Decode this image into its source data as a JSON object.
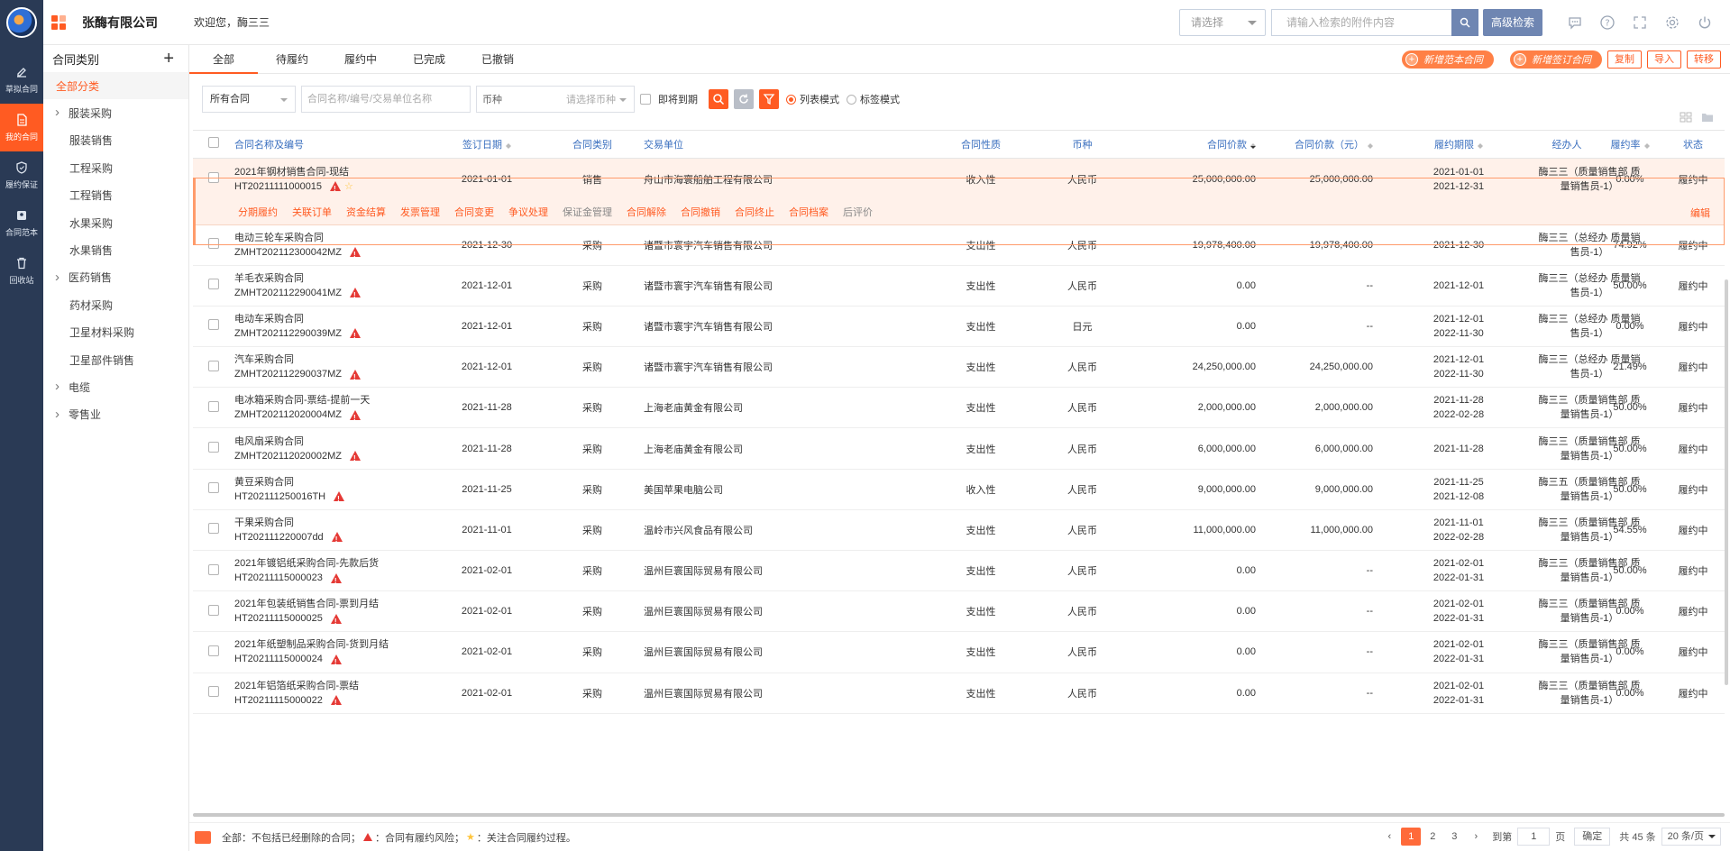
{
  "rail": {
    "items": [
      {
        "label": "草拟合同",
        "icon": "edit-icon",
        "active": false
      },
      {
        "label": "我的合同",
        "icon": "document-icon",
        "active": true
      },
      {
        "label": "履约保证",
        "icon": "shield-icon",
        "active": false
      },
      {
        "label": "合同范本",
        "icon": "template-icon",
        "active": false
      },
      {
        "label": "回收站",
        "icon": "trash-icon",
        "active": false
      }
    ]
  },
  "header": {
    "company": "张酶有限公司",
    "welcome": "欢迎您，酶三三",
    "select_placeholder": "请选择",
    "search_placeholder": "请输入检索的附件内容",
    "advanced_search": "高级检索"
  },
  "sidebar": {
    "title": "合同类别",
    "items": [
      {
        "label": "全部分类",
        "type": "active"
      },
      {
        "label": "服装采购",
        "type": "parent"
      },
      {
        "label": "服装销售",
        "type": "child"
      },
      {
        "label": "工程采购",
        "type": "child"
      },
      {
        "label": "工程销售",
        "type": "child"
      },
      {
        "label": "水果采购",
        "type": "child"
      },
      {
        "label": "水果销售",
        "type": "child"
      },
      {
        "label": "医药销售",
        "type": "parent"
      },
      {
        "label": "药材采购",
        "type": "child"
      },
      {
        "label": "卫星材料采购",
        "type": "child"
      },
      {
        "label": "卫星部件销售",
        "type": "child"
      },
      {
        "label": "电缆",
        "type": "parent"
      },
      {
        "label": "零售业",
        "type": "parent"
      }
    ]
  },
  "tabs": [
    "全部",
    "待履约",
    "履约中",
    "已完成",
    "已撤销"
  ],
  "actions": {
    "new_template": "新增范本合同",
    "new_signed": "新增签订合同",
    "copy": "复制",
    "import": "导入",
    "transfer": "转移"
  },
  "filters": {
    "contract_scope": "所有合同",
    "keyword_placeholder": "合同名称/编号/交易单位名称",
    "currency_label": "币种",
    "currency_placeholder": "请选择币种",
    "expiring": "即将到期",
    "list_mode": "列表模式",
    "tag_mode": "标签模式"
  },
  "table": {
    "columns": [
      "合同名称及编号",
      "签订日期",
      "合同类别",
      "交易单位",
      "合同性质",
      "币种",
      "合同价款",
      "合同价款（元）",
      "履约期限",
      "经办人",
      "履约率",
      "状态"
    ],
    "row_actions": [
      "分期履约",
      "关联订单",
      "资金结算",
      "发票管理",
      "合同变更",
      "争议处理",
      "保证金管理",
      "合同解除",
      "合同撤销",
      "合同终止",
      "合同档案",
      "后评价"
    ],
    "edit_label": "编辑",
    "rows": [
      {
        "name": "2021年钢材销售合同-现结",
        "no": "HT20211111000015",
        "star": true,
        "date": "2021-01-01",
        "category": "销售",
        "party": "舟山市海寰船舶工程有限公司",
        "nature": "收入性",
        "currency": "人民币",
        "price": "25,000,000.00",
        "price_cny": "25,000,000.00",
        "term1": "2021-01-01",
        "term2": "2021-12-31",
        "manager": "酶三三（质量销售部 质量销售员-1）",
        "rate": "0.00%",
        "status": "履约中"
      },
      {
        "name": "电动三轮车采购合同",
        "no": "ZMHT202112300042MZ",
        "star": false,
        "date": "2021-12-30",
        "category": "采购",
        "party": "诸暨市寰宇汽车销售有限公司",
        "nature": "支出性",
        "currency": "人民币",
        "price": "19,978,400.00",
        "price_cny": "19,978,400.00",
        "term1": "2021-12-30",
        "term2": "",
        "manager": "酶三三（总经办 质量销售员-1）",
        "rate": "74.92%",
        "status": "履约中"
      },
      {
        "name": "羊毛衣采购合同",
        "no": "ZMHT202112290041MZ",
        "star": false,
        "date": "2021-12-01",
        "category": "采购",
        "party": "诸暨市寰宇汽车销售有限公司",
        "nature": "支出性",
        "currency": "人民币",
        "price": "0.00",
        "price_cny": "--",
        "term1": "2021-12-01",
        "term2": "",
        "manager": "酶三三（总经办 质量销售员-1）",
        "rate": "50.00%",
        "status": "履约中"
      },
      {
        "name": "电动车采购合同",
        "no": "ZMHT202112290039MZ",
        "star": false,
        "date": "2021-12-01",
        "category": "采购",
        "party": "诸暨市寰宇汽车销售有限公司",
        "nature": "支出性",
        "currency": "日元",
        "price": "0.00",
        "price_cny": "--",
        "term1": "2021-12-01",
        "term2": "2022-11-30",
        "manager": "酶三三（总经办 质量销售员-1）",
        "rate": "0.00%",
        "status": "履约中"
      },
      {
        "name": "汽车采购合同",
        "no": "ZMHT202112290037MZ",
        "star": false,
        "date": "2021-12-01",
        "category": "采购",
        "party": "诸暨市寰宇汽车销售有限公司",
        "nature": "支出性",
        "currency": "人民币",
        "price": "24,250,000.00",
        "price_cny": "24,250,000.00",
        "term1": "2021-12-01",
        "term2": "2022-11-30",
        "manager": "酶三三（总经办 质量销售员-1）",
        "rate": "21.49%",
        "status": "履约中"
      },
      {
        "name": "电冰箱采购合同-票结-提前一天",
        "no": "ZMHT202112020004MZ",
        "star": false,
        "date": "2021-11-28",
        "category": "采购",
        "party": "上海老庙黄金有限公司",
        "nature": "支出性",
        "currency": "人民币",
        "price": "2,000,000.00",
        "price_cny": "2,000,000.00",
        "term1": "2021-11-28",
        "term2": "2022-02-28",
        "manager": "酶三三（质量销售部 质量销售员-1）",
        "rate": "50.00%",
        "status": "履约中"
      },
      {
        "name": "电风扇采购合同",
        "no": "ZMHT202112020002MZ",
        "star": false,
        "date": "2021-11-28",
        "category": "采购",
        "party": "上海老庙黄金有限公司",
        "nature": "支出性",
        "currency": "人民币",
        "price": "6,000,000.00",
        "price_cny": "6,000,000.00",
        "term1": "2021-11-28",
        "term2": "",
        "manager": "酶三三（质量销售部 质量销售员-1）",
        "rate": "50.00%",
        "status": "履约中"
      },
      {
        "name": "黄豆采购合同",
        "no": "HT202111250016TH",
        "star": false,
        "date": "2021-11-25",
        "category": "采购",
        "party": "美国苹果电脑公司",
        "nature": "收入性",
        "currency": "人民币",
        "price": "9,000,000.00",
        "price_cny": "9,000,000.00",
        "term1": "2021-11-25",
        "term2": "2021-12-08",
        "manager": "酶三五（质量销售部 质量销售员-1）",
        "rate": "50.00%",
        "status": "履约中"
      },
      {
        "name": "干果采购合同",
        "no": "HT202111220007dd",
        "star": false,
        "date": "2021-11-01",
        "category": "采购",
        "party": "温岭市兴风食品有限公司",
        "nature": "支出性",
        "currency": "人民币",
        "price": "11,000,000.00",
        "price_cny": "11,000,000.00",
        "term1": "2021-11-01",
        "term2": "2022-02-28",
        "manager": "酶三三（质量销售部 质量销售员-1）",
        "rate": "54.55%",
        "status": "履约中"
      },
      {
        "name": "2021年镀铝纸采购合同-先款后货",
        "no": "HT20211115000023",
        "star": false,
        "date": "2021-02-01",
        "category": "采购",
        "party": "温州巨寰国际贸易有限公司",
        "nature": "支出性",
        "currency": "人民币",
        "price": "0.00",
        "price_cny": "--",
        "term1": "2021-02-01",
        "term2": "2022-01-31",
        "manager": "酶三三（质量销售部 质量销售员-1）",
        "rate": "50.00%",
        "status": "履约中"
      },
      {
        "name": "2021年包装纸销售合同-票到月结",
        "no": "HT20211115000025",
        "star": false,
        "date": "2021-02-01",
        "category": "采购",
        "party": "温州巨寰国际贸易有限公司",
        "nature": "支出性",
        "currency": "人民币",
        "price": "0.00",
        "price_cny": "--",
        "term1": "2021-02-01",
        "term2": "2022-01-31",
        "manager": "酶三三（质量销售部 质量销售员-1）",
        "rate": "0.00%",
        "status": "履约中"
      },
      {
        "name": "2021年纸塑制品采购合同-货到月结",
        "no": "HT20211115000024",
        "star": false,
        "date": "2021-02-01",
        "category": "采购",
        "party": "温州巨寰国际贸易有限公司",
        "nature": "支出性",
        "currency": "人民币",
        "price": "0.00",
        "price_cny": "--",
        "term1": "2021-02-01",
        "term2": "2022-01-31",
        "manager": "酶三三（质量销售部 质量销售员-1）",
        "rate": "0.00%",
        "status": "履约中"
      },
      {
        "name": "2021年铝箔纸采购合同-票结",
        "no": "HT20211115000022",
        "star": false,
        "date": "2021-02-01",
        "category": "采购",
        "party": "温州巨寰国际贸易有限公司",
        "nature": "支出性",
        "currency": "人民币",
        "price": "0.00",
        "price_cny": "--",
        "term1": "2021-02-01",
        "term2": "2022-01-31",
        "manager": "酶三三（质量销售部 质量销售员-1）",
        "rate": "0.00%",
        "status": "履约中"
      }
    ]
  },
  "footer": {
    "note_prefix": "全部：不包括已经删除的合同；",
    "note_risk": "：合同有履约风险；",
    "note_star": "：关注合同履约过程。",
    "pages": [
      "1",
      "2",
      "3"
    ],
    "goto_label": "到第",
    "goto_value": "1",
    "page_unit": "页",
    "confirm": "确定",
    "total": "共 45 条",
    "page_size": "20 条/页"
  }
}
